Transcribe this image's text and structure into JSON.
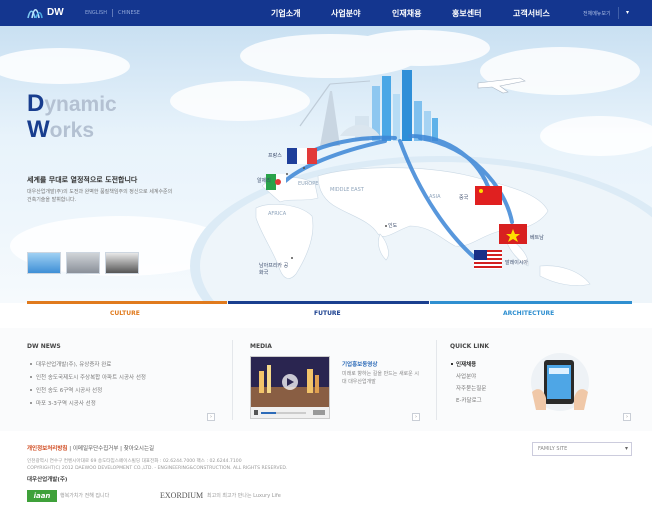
{
  "brand": {
    "name": "DW",
    "lang_en": "ENGLISH",
    "lang_cn": "CHINESE"
  },
  "gnb": [
    "기업소개",
    "사업분야",
    "인재채용",
    "홍보센터",
    "고객서비스"
  ],
  "all_menu": "전체메뉴보기",
  "hero": {
    "dyn_d": "D",
    "dyn_rest1": "ynamic",
    "dyn_w": "W",
    "dyn_rest2": "orks",
    "title": "세계를 무대로 열정적으로 도전합니다",
    "desc": "대우산업개발(주)의 도전과 완벽한 품질책임주의 정신으로 세계수준의 건축기술을 발휘합니다.",
    "map_labels": {
      "france": "프랑스",
      "algeria": "알제리",
      "europe": "EUROPE",
      "middle_east": "MIDDLE EAST",
      "africa": "AFRICA",
      "asia": "ASIA",
      "china": "중국",
      "vietnam": "베트남",
      "malaysia": "말레이시아",
      "india": "인도",
      "south_africa": "남아프리카 공화국"
    }
  },
  "categories": [
    {
      "label": "CULTURE",
      "color": "#e07a1d"
    },
    {
      "label": "FUTURE",
      "color": "#1a3f8f"
    },
    {
      "label": "ARCHITECTURE",
      "color": "#2f8fd0"
    }
  ],
  "news": {
    "title": "DW NEWS",
    "items": [
      "대우산업개발(주), 유상증자 완료",
      "인천 송도국제도시 주상복합 아파트 시공사 선정",
      "인천 송도 6구역 시공사 선정",
      "마포 3-3구역 시공사 선정"
    ]
  },
  "media": {
    "title": "MEDIA",
    "caption": "기업홍보동영상",
    "desc": "미래로 향하는 길을 만드는 새로운 시대 대우산업개발"
  },
  "quick": {
    "title": "QUICK LINK",
    "items": [
      "인재채용",
      "사업분야",
      "자주묻는질문",
      "E-카달로그"
    ]
  },
  "footer": {
    "links": [
      "개인정보처리방침",
      "이메일무단수집거부",
      "찾아오시는길"
    ],
    "address": "인천광역시 연수구 컨벤시아대로 69 송도타임스페이스빌딩  대표전화 : 02.6244.7000   팩스 : 02.6244.7100",
    "copyright": "COPYRIGHT(C) 2012 DAEWOO DEVELOPMENT CO.,LTD. - ENGINEERING&CONSTRUCTION. ALL RIGHTS RESERVED.",
    "company": "대우산업개발(주)",
    "family_site": "FAMILY SITE",
    "brand1": "iaan",
    "brand1_text": "행복가치가 전해 집니다",
    "brand2": "EXORDIUM",
    "brand2_text": "최고의 최고가 만나는 Luxury Life"
  }
}
